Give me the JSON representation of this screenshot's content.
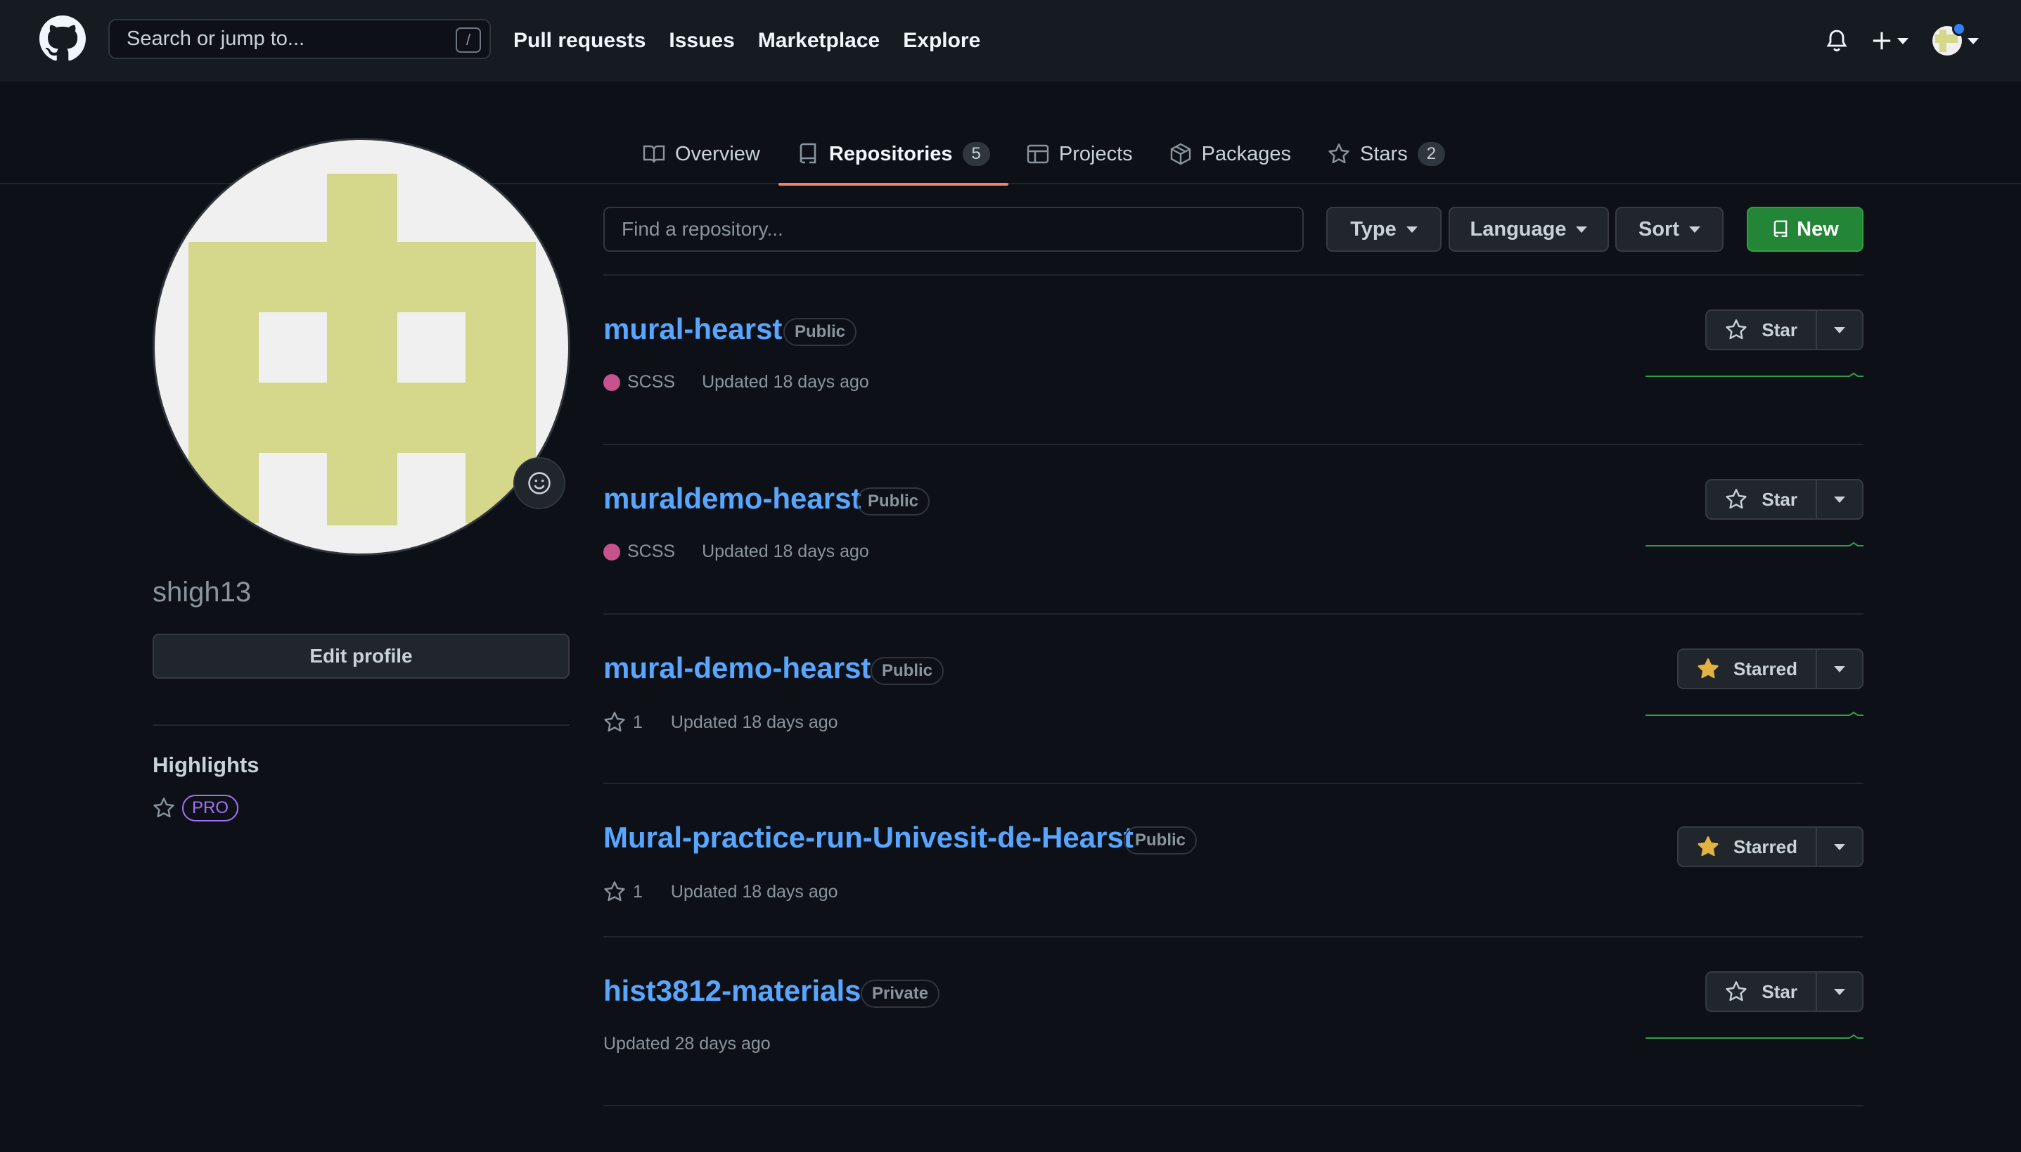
{
  "header": {
    "search_placeholder": "Search or jump to...",
    "search_shortcut": "/",
    "nav": [
      "Pull requests",
      "Issues",
      "Marketplace",
      "Explore"
    ]
  },
  "tabs": [
    {
      "label": "Overview",
      "icon": "book-icon"
    },
    {
      "label": "Repositories",
      "icon": "repo-icon",
      "count": "5",
      "active": true
    },
    {
      "label": "Projects",
      "icon": "table-icon"
    },
    {
      "label": "Packages",
      "icon": "package-icon"
    },
    {
      "label": "Stars",
      "icon": "star-icon",
      "count": "2"
    }
  ],
  "profile": {
    "username": "shigh13",
    "edit_label": "Edit profile",
    "highlights_title": "Highlights",
    "pro_label": "PRO"
  },
  "filters": {
    "find_placeholder": "Find a repository...",
    "type_label": "Type",
    "language_label": "Language",
    "sort_label": "Sort",
    "new_label": "New"
  },
  "repos": [
    {
      "name": "mural-hearst",
      "visibility": "Public",
      "language": "SCSS",
      "updated": "Updated 18 days ago",
      "star_label": "Star",
      "starred": false
    },
    {
      "name": "muraldemo-hearst",
      "visibility": "Public",
      "language": "SCSS",
      "updated": "Updated 18 days ago",
      "star_label": "Star",
      "starred": false
    },
    {
      "name": "mural-demo-hearst",
      "visibility": "Public",
      "stars": "1",
      "updated": "Updated 18 days ago",
      "star_label": "Starred",
      "starred": true
    },
    {
      "name": "Mural-practice-run-Univesit-de-Hearst",
      "visibility": "Public",
      "stars": "1",
      "updated": "Updated 18 days ago",
      "star_label": "Starred",
      "starred": true
    },
    {
      "name": "hist3812-materials",
      "visibility": "Private",
      "updated": "Updated 28 days ago",
      "star_label": "Star",
      "starred": false
    }
  ],
  "colors": {
    "scss": "#c6538c",
    "link": "#58a6ff",
    "accent_tab": "#f78166",
    "new_button": "#238636",
    "starred_icon": "#e3b341",
    "sparkline": "#2ea043"
  }
}
